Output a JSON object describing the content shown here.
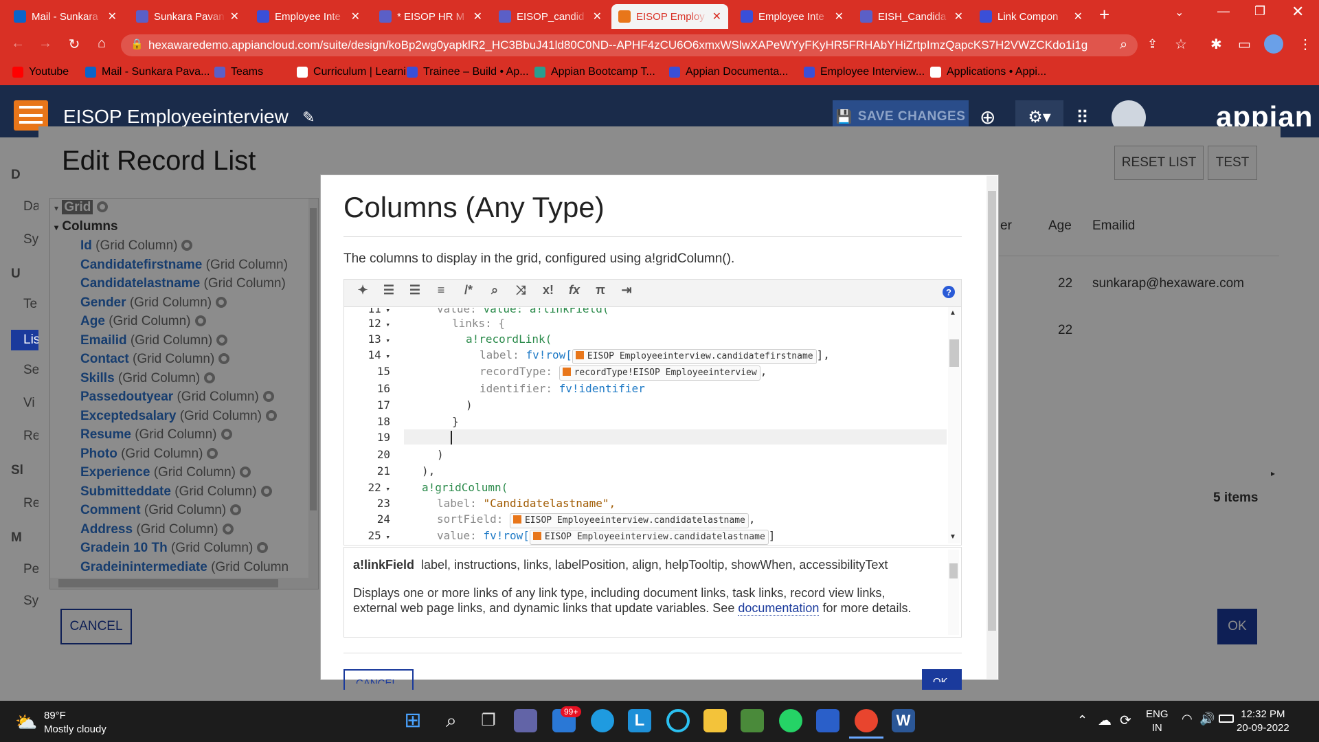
{
  "browser": {
    "tabs": [
      {
        "label": "Mail - Sunkara",
        "icon": "outlook-icon",
        "color": "#0a64c9"
      },
      {
        "label": "Sunkara Pavan",
        "icon": "teams-icon",
        "color": "#5b5fc7"
      },
      {
        "label": "Employee Inte",
        "icon": "appian-grid-icon",
        "color": "#3a4fd8"
      },
      {
        "label": "* EISOP HR M",
        "icon": "appian-page-icon",
        "color": "#5b5fc7"
      },
      {
        "label": "EISOP_candid",
        "icon": "record-icon",
        "color": "#5b5fc7"
      },
      {
        "label": "EISOP Employ",
        "icon": "record-icon",
        "color": "#e8761a"
      },
      {
        "label": "Employee Inte",
        "icon": "appian-grid-icon",
        "color": "#3a4fd8"
      },
      {
        "label": "EISH_Candida",
        "icon": "record-icon",
        "color": "#5b5fc7"
      },
      {
        "label": "Link Compon",
        "icon": "appian-a-icon",
        "color": "#3a4fd8"
      }
    ],
    "url": "hexawaredemo.appiancloud.com/suite/design/koBp2wg0yapklR2_HC3BbuJ41ld80C0ND--APHF4zCU6O6xmxWSlwXAPeWYyFKyHR5FRHAbYHiZrtpImzQapcKS7H2VWZCKdo1i1g",
    "bookmarks": [
      {
        "label": "Youtube",
        "icon": "youtube-icon"
      },
      {
        "label": "Mail - Sunkara Pava...",
        "icon": "outlook-icon"
      },
      {
        "label": "Teams",
        "icon": "teams-icon"
      },
      {
        "label": "Curriculum | Learni...",
        "icon": "curriculum-icon"
      },
      {
        "label": "Trainee – Build • Ap...",
        "icon": "appian-grid-icon"
      },
      {
        "label": "Appian Bootcamp T...",
        "icon": "bootcamp-icon"
      },
      {
        "label": "Appian Documenta...",
        "icon": "appian-a-icon"
      },
      {
        "label": "Employee Interview...",
        "icon": "appian-grid-icon"
      },
      {
        "label": "Applications • Appi...",
        "icon": "appian-a-icon"
      }
    ]
  },
  "app": {
    "title": "EISOP Employeeinterview",
    "save_label": "SAVE CHANGES",
    "logo": "appian"
  },
  "edit_list": {
    "title": "Edit Record List",
    "reset_label": "RESET LIST",
    "test_label": "TEST",
    "cancel_label": "CANCEL",
    "ok_label": "OK",
    "items_count": "5 items",
    "tree": {
      "root": "Grid",
      "columns_label": "Columns",
      "items": [
        {
          "name": "Id",
          "type": "(Grid Column)"
        },
        {
          "name": "Candidatefirstname",
          "type": "(Grid Column)"
        },
        {
          "name": "Candidatelastname",
          "type": "(Grid Column)"
        },
        {
          "name": "Gender",
          "type": "(Grid Column)"
        },
        {
          "name": "Age",
          "type": "(Grid Column)"
        },
        {
          "name": "Emailid",
          "type": "(Grid Column)"
        },
        {
          "name": "Contact",
          "type": "(Grid Column)"
        },
        {
          "name": "Skills",
          "type": "(Grid Column)"
        },
        {
          "name": "Passedoutyear",
          "type": "(Grid Column)"
        },
        {
          "name": "Exceptedsalary",
          "type": "(Grid Column)"
        },
        {
          "name": "Resume",
          "type": "(Grid Column)"
        },
        {
          "name": "Photo",
          "type": "(Grid Column)"
        },
        {
          "name": "Experience",
          "type": "(Grid Column)"
        },
        {
          "name": "Submitteddate",
          "type": "(Grid Column)"
        },
        {
          "name": "Comment",
          "type": "(Grid Column)"
        },
        {
          "name": "Address",
          "type": "(Grid Column)"
        },
        {
          "name": "Gradein 10 Th",
          "type": "(Grid Column)"
        },
        {
          "name": "Gradeinintermediate",
          "type": "(Grid Column"
        }
      ]
    },
    "preview": {
      "headers": [
        "er",
        "Age",
        "Emailid"
      ],
      "rows": [
        {
          "age": "22",
          "email": "sunkarap@hexaware.com"
        },
        {
          "age": "22",
          "email": ""
        }
      ]
    },
    "left_fragments": [
      "D",
      "Da",
      "Sy",
      "U",
      "Te",
      "Lis",
      "Se",
      "Vi",
      "Re",
      "Sl",
      "Re",
      "M",
      "Pe",
      "Sy"
    ]
  },
  "modal": {
    "title": "Columns (Any Type)",
    "description": "The columns to display in the grid, configured using a!gridColumn().",
    "help_icon": "?",
    "code_lines": [
      {
        "n": "11",
        "fold": true
      },
      {
        "n": "12",
        "fold": true
      },
      {
        "n": "13",
        "fold": true
      },
      {
        "n": "14",
        "fold": true
      },
      {
        "n": "15",
        "fold": false
      },
      {
        "n": "16",
        "fold": false
      },
      {
        "n": "17",
        "fold": false
      },
      {
        "n": "18",
        "fold": false
      },
      {
        "n": "19",
        "fold": false
      },
      {
        "n": "20",
        "fold": false
      },
      {
        "n": "21",
        "fold": false
      },
      {
        "n": "22",
        "fold": true
      },
      {
        "n": "23",
        "fold": false
      },
      {
        "n": "24",
        "fold": false
      },
      {
        "n": "25",
        "fold": true
      }
    ],
    "code": {
      "l11": "value: a!linkField(",
      "l12a": "links: {",
      "l13": "a!recordLink(",
      "l14_label": "label: ",
      "l14_fv": "fv!row[",
      "l14_chip": "EISOP Employeeinterview.candidatefirstname",
      "l14_end": "],",
      "l15_label": "recordType: ",
      "l15_chip": "recordType!EISOP Employeeinterview",
      "l15_end": ",",
      "l16_label": "identifier: ",
      "l16_val": "fv!identifier",
      "l17": ")",
      "l18": "}",
      "l20": ")",
      "l21": "),",
      "l22": "a!gridColumn(",
      "l23_label": "label: ",
      "l23_val": "\"Candidatelastname\",",
      "l24_label": "sortField: ",
      "l24_chip": "EISOP Employeeinterview.candidatelastname",
      "l24_end": ",",
      "l25_label": "value: ",
      "l25_fv": "fv!row[",
      "l25_chip": "EISOP Employeeinterview.candidatelastname",
      "l25_end": "]"
    },
    "doc_signature_name": "a!linkField",
    "doc_signature_params": "label, instructions, links, labelPosition, align, helpTooltip, showWhen, accessibilityText",
    "doc_body_pre": "Displays one or more links of any link type, including document links, task links, record view links, external web page links, and dynamic links that update variables. See ",
    "doc_link": "documentation",
    "doc_body_post": " for more details.",
    "cancel_label": "CANCEL",
    "ok_label": "OK"
  },
  "taskbar": {
    "weather_temp": "89°F",
    "weather_desc": "Mostly cloudy",
    "mail_badge": "99+",
    "lang_1": "ENG",
    "lang_2": "IN",
    "time": "12:32 PM",
    "date": "20-09-2022"
  },
  "colors": {
    "chrome_red": "#d93025",
    "appian_navy": "#1a2b4a",
    "primary_blue": "#1a3a9c",
    "link_blue": "#2a6fc9"
  }
}
